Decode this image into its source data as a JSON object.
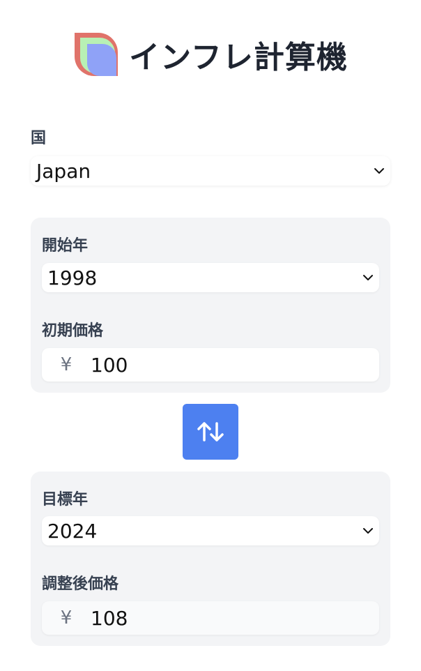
{
  "header": {
    "title": "インフレ計算機",
    "logo_icon": "app-logo-icon"
  },
  "country": {
    "label": "国",
    "selected": "Japan"
  },
  "start": {
    "year_label": "開始年",
    "year_selected": "1998",
    "price_label": "初期価格",
    "currency_symbol": "¥",
    "price_value": "100"
  },
  "swap": {
    "icon": "swap-vertical-icon",
    "color": "#4d80f0"
  },
  "target": {
    "year_label": "目標年",
    "year_selected": "2024",
    "price_label": "調整後価格",
    "currency_symbol": "¥",
    "price_value": "108"
  },
  "colors": {
    "card_background": "#f3f4f6",
    "text_primary": "#1e2430",
    "logo_red": "#e0736a",
    "logo_green": "#b8f0b4",
    "logo_blue": "#8fa2f7"
  }
}
